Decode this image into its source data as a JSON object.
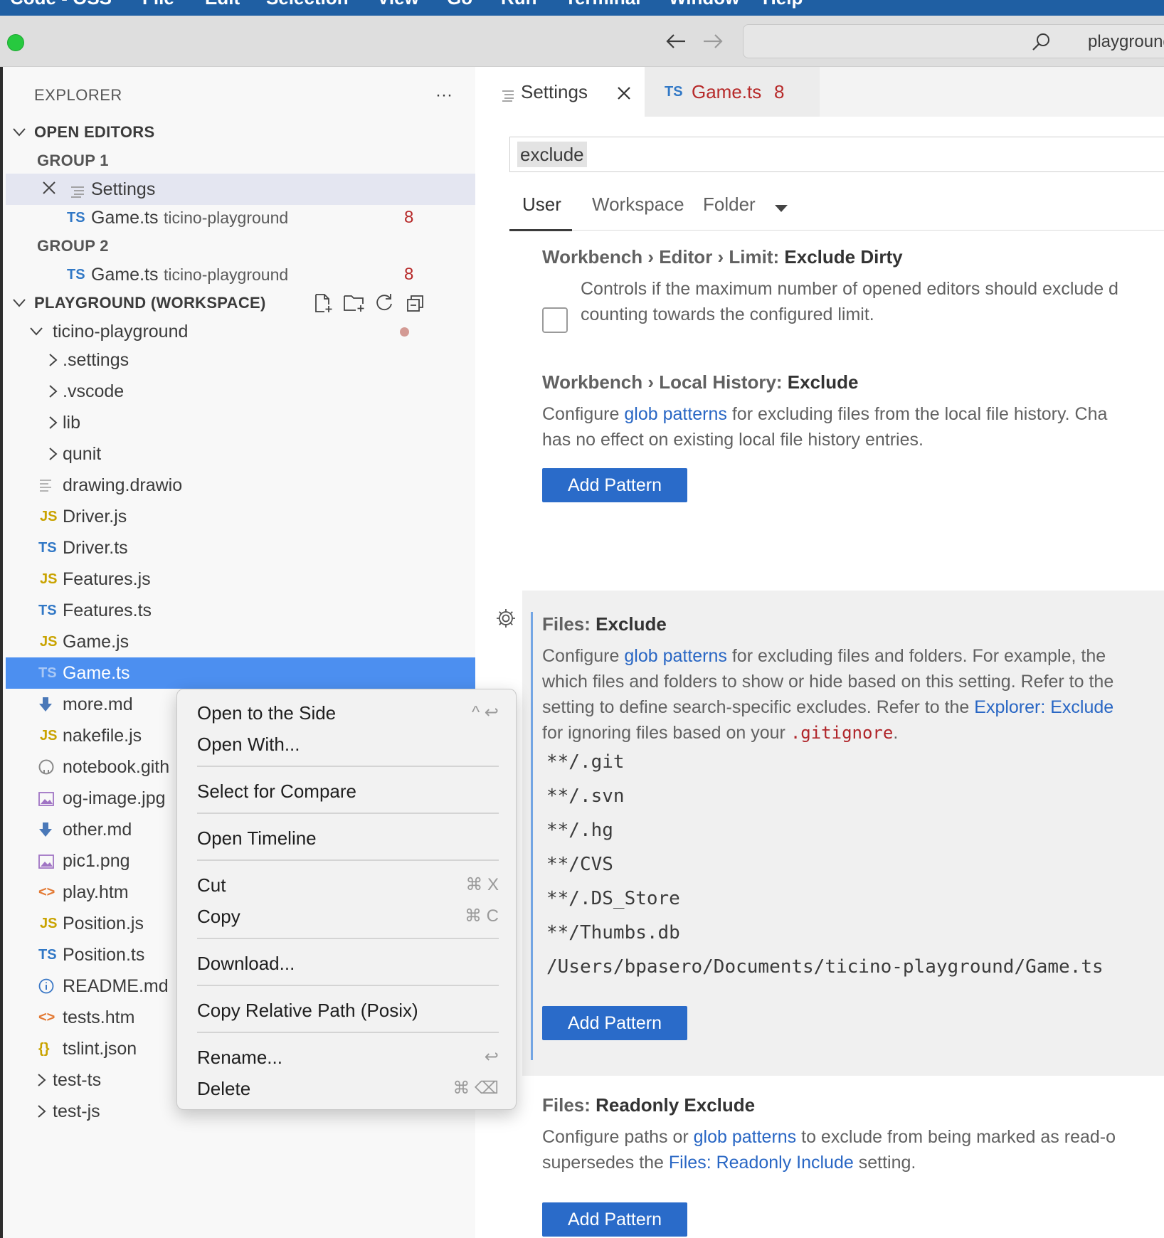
{
  "menubar": {
    "app": "Code - OSS",
    "items": [
      "File",
      "Edit",
      "Selection",
      "View",
      "Go",
      "Run",
      "Terminal",
      "Window",
      "Help"
    ]
  },
  "titlebar": {
    "command_center": "playground"
  },
  "explorer": {
    "title": "EXPLORER",
    "more": "···",
    "open_editors": "OPEN EDITORS",
    "group1": "GROUP 1",
    "group2": "GROUP 2",
    "oe_settings": "Settings",
    "oe_game1": {
      "badge": "TS",
      "name": "Game.ts",
      "desc": "ticino-playground",
      "count": "8"
    },
    "oe_game2": {
      "badge": "TS",
      "name": "Game.ts",
      "desc": "ticino-playground",
      "count": "8"
    },
    "workspace": "PLAYGROUND (WORKSPACE)",
    "root": "ticino-playground",
    "folders": [
      ".settings",
      ".vscode",
      "lib",
      "qunit"
    ],
    "files": [
      {
        "badge": "",
        "name": "drawing.drawio"
      },
      {
        "badge": "JS",
        "name": "Driver.js"
      },
      {
        "badge": "TS",
        "name": "Driver.ts"
      },
      {
        "badge": "JS",
        "name": "Features.js"
      },
      {
        "badge": "TS",
        "name": "Features.ts"
      },
      {
        "badge": "JS",
        "name": "Game.js"
      },
      {
        "badge": "TS",
        "name": "Game.ts"
      },
      {
        "badge": "",
        "name": "more.md"
      },
      {
        "badge": "JS",
        "name": "nakefile.js"
      },
      {
        "badge": "",
        "name": "notebook.gith"
      },
      {
        "badge": "",
        "name": "og-image.jpg"
      },
      {
        "badge": "",
        "name": "other.md"
      },
      {
        "badge": "",
        "name": "pic1.png"
      },
      {
        "badge": "<>",
        "name": "play.htm"
      },
      {
        "badge": "JS",
        "name": "Position.js"
      },
      {
        "badge": "TS",
        "name": "Position.ts"
      },
      {
        "badge": "",
        "name": "README.md"
      },
      {
        "badge": "<>",
        "name": "tests.htm"
      },
      {
        "badge": "{}",
        "name": "tslint.json"
      }
    ],
    "bottom_folders": [
      "test-ts",
      "test-js"
    ]
  },
  "tabs": {
    "settings": "Settings",
    "game_badge": "TS",
    "game": "Game.ts",
    "game_count": "8"
  },
  "settings": {
    "search_value": "exclude",
    "scopes": [
      "User",
      "Workspace",
      "Folder"
    ],
    "s1": {
      "prefix": "Workbench › Editor › Limit: ",
      "name": "Exclude Dirty",
      "line1": "Controls if the maximum number of opened editors should exclude d",
      "line2": "counting towards the configured limit."
    },
    "s2": {
      "prefix": "Workbench › Local History: ",
      "name": "Exclude",
      "line1_a": "Configure ",
      "link": "glob patterns",
      "line1_b": " for excluding files from the local file history. Cha",
      "line2": "has no effect on existing local file history entries.",
      "button": "Add Pattern"
    },
    "s3": {
      "prefix": "Files: ",
      "name": "Exclude",
      "line1_a": "Configure ",
      "link": "glob patterns",
      "line1_b": " for excluding files and folders. For example, the",
      "line2": "which files and folders to show or hide based on this setting. Refer to the",
      "line3_a": "setting to define search-specific excludes. Refer to the ",
      "line3_link": "Explorer: Exclude",
      "line4_a": "for ignoring files based on your ",
      "line4_code": ".gitignore",
      "line4_b": ".",
      "globs": [
        "**/.git",
        "**/.svn",
        "**/.hg",
        "**/CVS",
        "**/.DS_Store",
        "**/Thumbs.db",
        "/Users/bpasero/Documents/ticino-playground/Game.ts"
      ],
      "button": "Add Pattern"
    },
    "s4": {
      "prefix": "Files: ",
      "name": "Readonly Exclude",
      "line1_a": "Configure paths or ",
      "link": "glob patterns",
      "line1_b": " to exclude from being marked as read-o",
      "line2_a": "supersedes the ",
      "line2_link": "Files: Readonly Include",
      "line2_b": " setting.",
      "button": "Add Pattern"
    }
  },
  "context_menu": {
    "open_side": "Open to the Side",
    "open_side_kb": "^ ↩",
    "open_with": "Open With...",
    "compare": "Select for Compare",
    "timeline": "Open Timeline",
    "cut": "Cut",
    "cut_kb": "⌘ X",
    "copy": "Copy",
    "copy_kb": "⌘ C",
    "download": "Download...",
    "rel_path": "Copy Relative Path (Posix)",
    "rename": "Rename...",
    "rename_kb": "↩",
    "delete": "Delete",
    "delete_kb": "⌘ ⌫"
  }
}
